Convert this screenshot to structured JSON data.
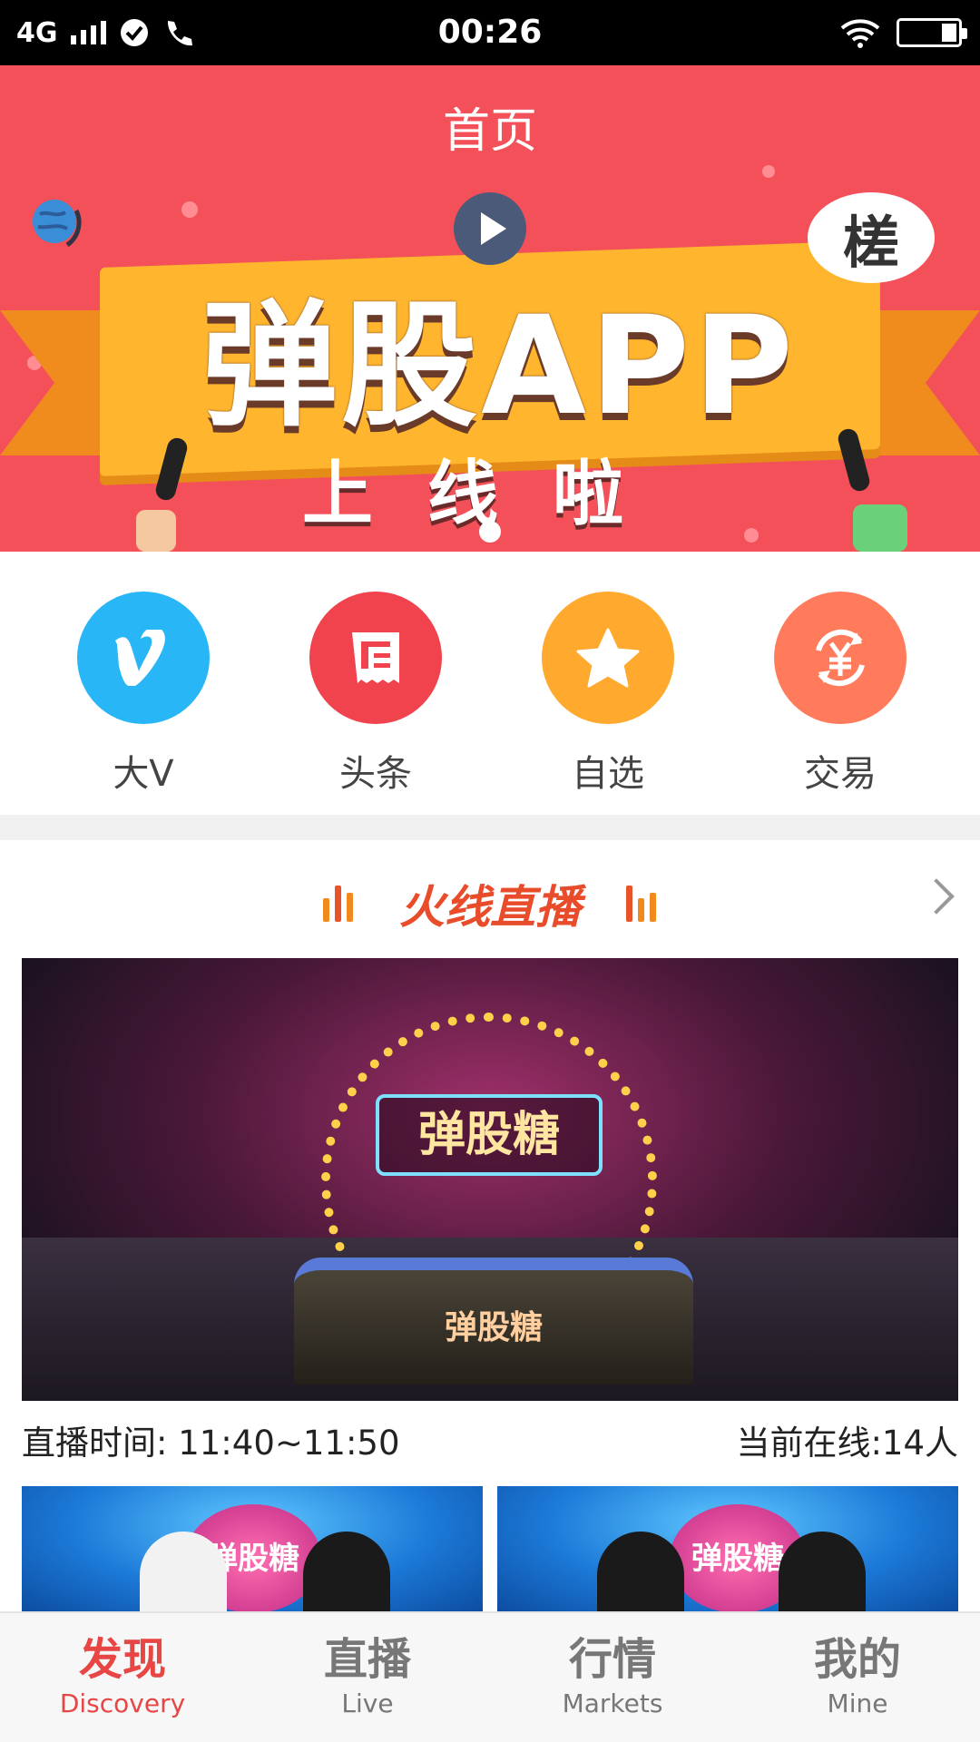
{
  "status_bar": {
    "network": "4G",
    "time": "00:26",
    "icons": [
      "signal-icon",
      "check-circle-icon",
      "phone-icon",
      "wifi-icon",
      "battery-icon"
    ]
  },
  "header": {
    "title": "首页"
  },
  "banner": {
    "headline": "弹股APP",
    "subline": "上线啦",
    "bubble_text": "槎",
    "slide_count": 1,
    "active_slide": 1
  },
  "shortcuts": [
    {
      "label": "大V",
      "icon": "vimeo-v-icon",
      "color": "#29b6f6"
    },
    {
      "label": "头条",
      "icon": "newspaper-icon",
      "color": "#f0434d"
    },
    {
      "label": "自选",
      "icon": "star-icon",
      "color": "#ffa92e"
    },
    {
      "label": "交易",
      "icon": "yen-exchange-icon",
      "color": "#ff7b5c"
    }
  ],
  "live_section": {
    "title": "火线直播",
    "featured": {
      "sign_text": "弹股糖",
      "desk_text": "弹股糖",
      "time_label": "直播时间:  11:40~11:50",
      "online_label": "当前在线:14人"
    },
    "thumbnails": [
      {
        "logo_text": "弹股糖"
      },
      {
        "logo_text": "弹股糖"
      }
    ]
  },
  "tabbar": {
    "tabs": [
      {
        "zh": "发现",
        "en": "Discovery",
        "active": true
      },
      {
        "zh": "直播",
        "en": "Live",
        "active": false
      },
      {
        "zh": "行情",
        "en": "Markets",
        "active": false
      },
      {
        "zh": "我的",
        "en": "Mine",
        "active": false
      }
    ]
  },
  "colors": {
    "header_red": "#f4505a",
    "accent_red": "#e84545",
    "section_title": "#e84c2a"
  }
}
